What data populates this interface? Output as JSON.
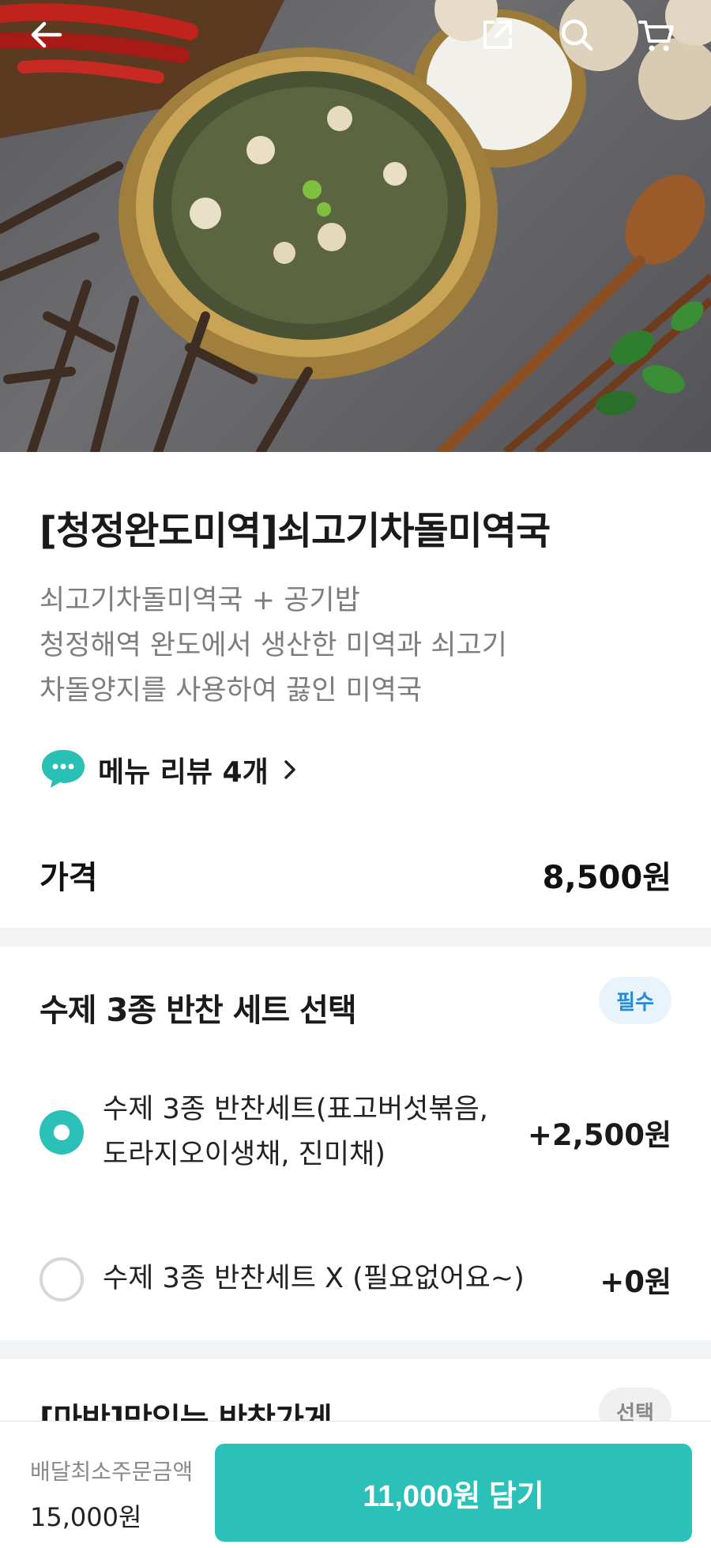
{
  "header": {
    "icons": [
      "back-arrow-icon",
      "share-icon",
      "search-icon",
      "cart-icon"
    ]
  },
  "product": {
    "title": "[청정완도미역]쇠고기차돌미역국",
    "description": [
      "쇠고기차돌미역국 + 공기밥",
      "청정해역 완도에서 생산한 미역과 쇠고기",
      "차돌양지를 사용하여 끓인 미역국"
    ],
    "review_label": "메뉴 리뷰 4개",
    "price_label": "가격",
    "price_value": "8,500원"
  },
  "option_group_1": {
    "title": "수제 3종 반찬 세트 선택",
    "badge": "필수",
    "options": [
      {
        "label_line1": "수제 3종 반찬세트(표고버섯볶음,",
        "label_line2": "도라지오이생채, 진미채)",
        "price": "+2,500원",
        "selected": true
      },
      {
        "label_line1": "수제 3종 반찬세트 X (필요없어요~)",
        "label_line2": "",
        "price": "+0원",
        "selected": false
      }
    ]
  },
  "option_group_2": {
    "title": "[마반]맛있는 반찬가게",
    "badge": "선택"
  },
  "footer": {
    "min_order_label": "배달최소주문금액",
    "min_order_value": "15,000원",
    "add_button": "11,000원 담기"
  },
  "colors": {
    "accent": "#2bc0b8",
    "required_badge": "#2a8ad8"
  }
}
